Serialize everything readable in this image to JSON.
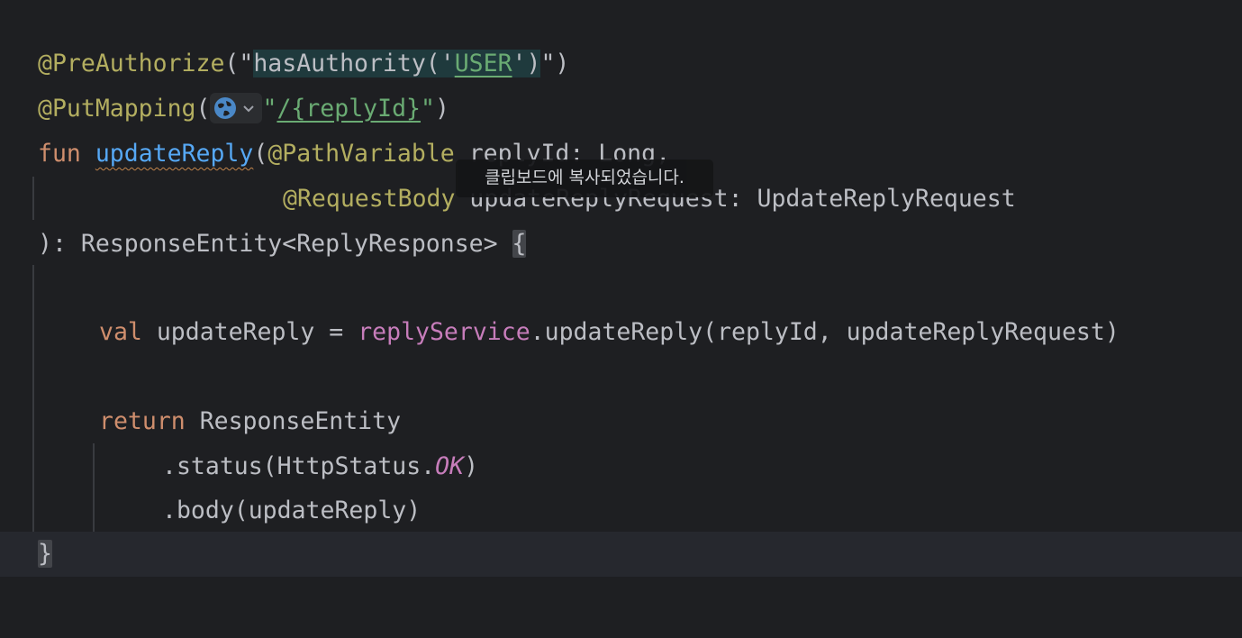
{
  "editor": {
    "lines": [
      {
        "annotation": "@PreAuthorize",
        "open": "(\"",
        "injected": "hasAuthority('",
        "injected_arg": "USER",
        "injected_close": "')",
        "close": "\")"
      },
      {
        "annotation": "@PutMapping",
        "open": "(",
        "string_open": "\"",
        "path": "/{replyId}",
        "string_close": "\"",
        "close": ")"
      },
      {
        "keyword": "fun",
        "function_name": "updateReply",
        "paren": "(",
        "annotation": "@PathVariable",
        "param": " replyId: Long,"
      },
      {
        "annotation": "@RequestBody",
        "param": " updateReplyRequest: UpdateReplyRequest"
      },
      {
        "prefix": "): ",
        "return_type": "ResponseEntity<ReplyResponse> ",
        "brace": "{"
      },
      {
        "text": ""
      },
      {
        "keyword": "val",
        "var_part": " updateReply = ",
        "receiver": "replyService",
        "call": ".updateReply(replyId, updateReplyRequest)"
      },
      {
        "text": ""
      },
      {
        "keyword": "return",
        "rest": " ResponseEntity"
      },
      {
        "pre": ".status(HttpStatus.",
        "enum": "OK",
        "post": ")"
      },
      {
        "text": ".body(updateReply)"
      },
      {
        "brace": "}"
      }
    ],
    "inlay_icons": [
      "globe-icon",
      "chevron-down-icon"
    ],
    "colors": {
      "background": "#1e1f22",
      "annotation": "#b3ae60",
      "string": "#6aab73",
      "keyword": "#cf8e6d",
      "function": "#56a8f5",
      "property": "#c77dbb"
    }
  },
  "tooltip": {
    "text": "클립보드에 복사되었습니다."
  }
}
